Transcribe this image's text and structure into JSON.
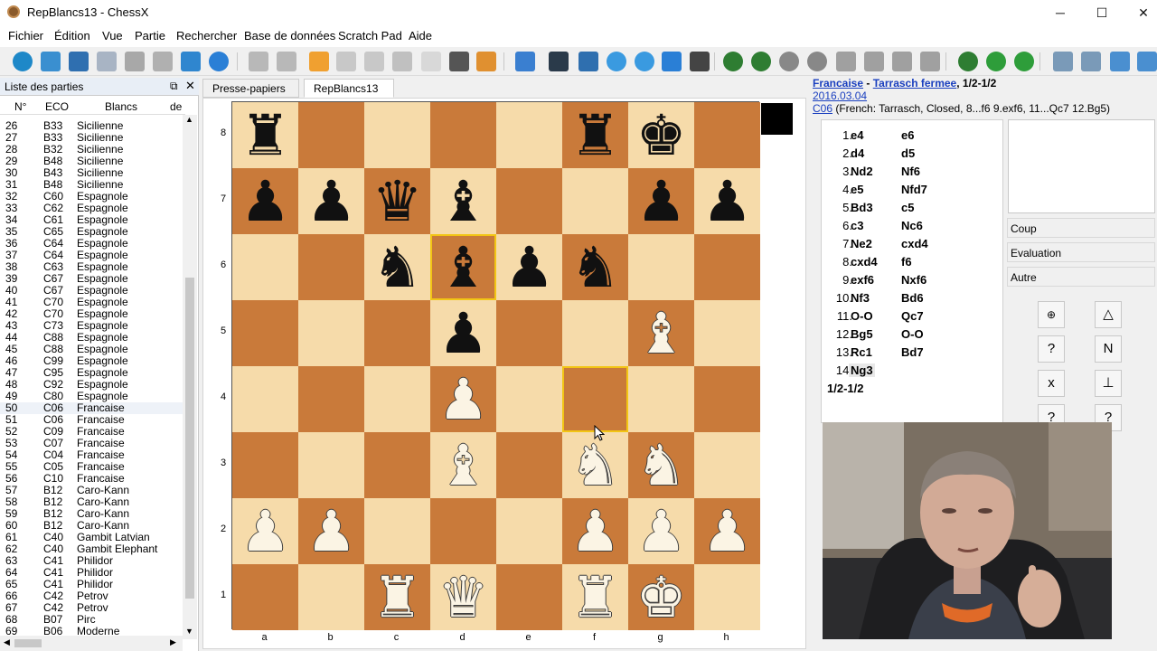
{
  "window": {
    "title": "RepBlancs13 - ChessX",
    "minimize": "─",
    "maximize": "☐",
    "close": "✕"
  },
  "menu": [
    "Fichier",
    "Édition",
    "Vue",
    "Partie",
    "Rechercher",
    "Base de données",
    "Scratch Pad",
    "Aide"
  ],
  "toolbar_icons": [
    {
      "name": "gear-icon",
      "color": "#1e88c8"
    },
    {
      "name": "open-folder-icon",
      "color": "#3a8fd0"
    },
    {
      "name": "fics-icon",
      "color": "#2f6fb0"
    },
    {
      "name": "database-icon",
      "color": "#a8b4c4"
    },
    {
      "name": "save-icon",
      "color": "#a8a8a8"
    },
    {
      "name": "pen-icon",
      "color": "#b0b0b0"
    },
    {
      "name": "folder-icon",
      "color": "#2f86cf"
    },
    {
      "name": "help-icon",
      "color": "#2a7fd6"
    },
    {
      "name": "undo-icon",
      "color": "#b8b8b8"
    },
    {
      "name": "redo-icon",
      "color": "#b8b8b8"
    },
    {
      "name": "pencil-icon",
      "color": "#f0a030"
    },
    {
      "name": "paste-icon",
      "color": "#c8c8c8"
    },
    {
      "name": "copy-icon",
      "color": "#c8c8c8"
    },
    {
      "name": "puzzle-icon",
      "color": "#c0c0c0"
    },
    {
      "name": "document-icon",
      "color": "#d8d8d8"
    },
    {
      "name": "camera-icon",
      "color": "#555555"
    },
    {
      "name": "clipboard-icon",
      "color": "#e09030"
    },
    {
      "name": "flip-board-icon",
      "color": "#3a7fd0"
    },
    {
      "name": "knight-icon",
      "color": "#2a3a4a"
    },
    {
      "name": "engine-icon",
      "color": "#2f6faf"
    },
    {
      "name": "play-icon",
      "color": "#3a9ae0"
    },
    {
      "name": "fast-forward-icon",
      "color": "#3a9ae0"
    },
    {
      "name": "shuffle-icon",
      "color": "#2a7fd6"
    },
    {
      "name": "film-icon",
      "color": "#444444"
    },
    {
      "name": "first-move-icon",
      "color": "#2e7d32"
    },
    {
      "name": "rewind-icon",
      "color": "#2e7d32"
    },
    {
      "name": "forward-icon",
      "color": "#888888"
    },
    {
      "name": "last-move-icon",
      "color": "#888888"
    },
    {
      "name": "refresh-icon",
      "color": "#a0a0a0"
    },
    {
      "name": "up-icon",
      "color": "#a0a0a0"
    },
    {
      "name": "down-icon",
      "color": "#a0a0a0"
    },
    {
      "name": "back-icon",
      "color": "#a0a0a0"
    },
    {
      "name": "new-variation-icon",
      "color": "#2e7d32"
    },
    {
      "name": "promote-icon",
      "color": "#2e9d3a"
    },
    {
      "name": "demote-icon",
      "color": "#2e9d3a"
    },
    {
      "name": "search-board-icon",
      "color": "#7a9ab8"
    },
    {
      "name": "magnifier-icon",
      "color": "#7a9ab8"
    },
    {
      "name": "filter-icon",
      "color": "#4a8fd0"
    },
    {
      "name": "arrow-icon",
      "color": "#4a8fd0"
    }
  ],
  "game_list": {
    "title": "Liste des parties",
    "columns": [
      "N°",
      "ECO",
      "Blancs",
      "de"
    ],
    "selected": "50",
    "rows": [
      [
        "26",
        "B33",
        "Sicilienne"
      ],
      [
        "27",
        "B33",
        "Sicilienne"
      ],
      [
        "28",
        "B32",
        "Sicilienne"
      ],
      [
        "29",
        "B48",
        "Sicilienne"
      ],
      [
        "30",
        "B43",
        "Sicilienne"
      ],
      [
        "31",
        "B48",
        "Sicilienne"
      ],
      [
        "32",
        "C60",
        "Espagnole"
      ],
      [
        "33",
        "C62",
        "Espagnole"
      ],
      [
        "34",
        "C61",
        "Espagnole"
      ],
      [
        "35",
        "C65",
        "Espagnole"
      ],
      [
        "36",
        "C64",
        "Espagnole"
      ],
      [
        "37",
        "C64",
        "Espagnole"
      ],
      [
        "38",
        "C63",
        "Espagnole"
      ],
      [
        "39",
        "C67",
        "Espagnole"
      ],
      [
        "40",
        "C67",
        "Espagnole"
      ],
      [
        "41",
        "C70",
        "Espagnole"
      ],
      [
        "42",
        "C70",
        "Espagnole"
      ],
      [
        "43",
        "C73",
        "Espagnole"
      ],
      [
        "44",
        "C88",
        "Espagnole"
      ],
      [
        "45",
        "C88",
        "Espagnole"
      ],
      [
        "46",
        "C99",
        "Espagnole"
      ],
      [
        "47",
        "C95",
        "Espagnole"
      ],
      [
        "48",
        "C92",
        "Espagnole"
      ],
      [
        "49",
        "C80",
        "Espagnole"
      ],
      [
        "50",
        "C06",
        "Francaise"
      ],
      [
        "51",
        "C06",
        "Francaise"
      ],
      [
        "52",
        "C09",
        "Francaise"
      ],
      [
        "53",
        "C07",
        "Francaise"
      ],
      [
        "54",
        "C04",
        "Francaise"
      ],
      [
        "55",
        "C05",
        "Francaise"
      ],
      [
        "56",
        "C10",
        "Francaise"
      ],
      [
        "57",
        "B12",
        "Caro-Kann"
      ],
      [
        "58",
        "B12",
        "Caro-Kann"
      ],
      [
        "59",
        "B12",
        "Caro-Kann"
      ],
      [
        "60",
        "B12",
        "Caro-Kann"
      ],
      [
        "61",
        "C40",
        "Gambit Latvian"
      ],
      [
        "62",
        "C40",
        "Gambit Elephant"
      ],
      [
        "63",
        "C41",
        "Philidor"
      ],
      [
        "64",
        "C41",
        "Philidor"
      ],
      [
        "65",
        "C41",
        "Philidor"
      ],
      [
        "66",
        "C42",
        "Petrov"
      ],
      [
        "67",
        "C42",
        "Petrov"
      ],
      [
        "68",
        "B07",
        "Pirc"
      ],
      [
        "69",
        "B06",
        "Moderne"
      ]
    ]
  },
  "tabs": [
    {
      "label": "Presse-papiers",
      "close": "✕"
    },
    {
      "label": "RepBlancs13",
      "close": "✕"
    }
  ],
  "board": {
    "files": [
      "a",
      "b",
      "c",
      "d",
      "e",
      "f",
      "g",
      "h"
    ],
    "ranks": [
      "8",
      "7",
      "6",
      "5",
      "4",
      "3",
      "2",
      "1"
    ],
    "pieces": {
      "a8": "bR",
      "f8": "bR",
      "g8": "bK",
      "a7": "bP",
      "b7": "bP",
      "c7": "bQ",
      "d7": "bB",
      "g7": "bP",
      "h7": "bP",
      "c6": "bN",
      "d6": "bB",
      "e6": "bP",
      "f6": "bN",
      "d5": "bP",
      "g5": "wB",
      "d4": "wP",
      "d3": "wB",
      "f3": "wN",
      "g3": "wN",
      "a2": "wP",
      "b2": "wP",
      "f2": "wP",
      "g2": "wP",
      "h2": "wP",
      "c1": "wR",
      "d1": "wQ",
      "f1": "wR",
      "g1": "wK"
    },
    "highlighted": [
      "d6",
      "f4"
    ],
    "side_to_move": "black"
  },
  "game_info": {
    "opening": "Francaise",
    "sep": "-",
    "variation": "Tarrasch fermee",
    "result": ", 1/2-1/2",
    "date": "2016.03.04",
    "eco_code": "C06",
    "eco_desc": " (French: Tarrasch, Closed, 8...f6 9.exf6, 11...Qc7 12.Bg5)"
  },
  "moves": [
    {
      "n": "1.",
      "w": "e4",
      "b": "e6"
    },
    {
      "n": "2.",
      "w": "d4",
      "b": "d5"
    },
    {
      "n": "3.",
      "w": "Nd2",
      "b": "Nf6"
    },
    {
      "n": "4.",
      "w": "e5",
      "b": "Nfd7"
    },
    {
      "n": "5.",
      "w": "Bd3",
      "b": "c5"
    },
    {
      "n": "6.",
      "w": "c3",
      "b": "Nc6"
    },
    {
      "n": "7.",
      "w": "Ne2",
      "b": "cxd4"
    },
    {
      "n": "8.",
      "w": "cxd4",
      "b": "f6"
    },
    {
      "n": "9.",
      "w": "exf6",
      "b": "Nxf6"
    },
    {
      "n": "10.",
      "w": "Nf3",
      "b": "Bd6"
    },
    {
      "n": "11.",
      "w": "O-O",
      "b": "Qc7"
    },
    {
      "n": "12.",
      "w": "Bg5",
      "b": "O-O"
    },
    {
      "n": "13.",
      "w": "Rc1",
      "b": "Bd7"
    },
    {
      "n": "14.",
      "w": "Ng3",
      "b": ""
    }
  ],
  "result": "1/2-1/2",
  "annotation_sections": [
    "Coup",
    "Evaluation",
    "Autre"
  ],
  "nag_buttons": [
    "⊕",
    "△",
    "?",
    "N",
    "x",
    "⊥",
    "?",
    "?"
  ]
}
